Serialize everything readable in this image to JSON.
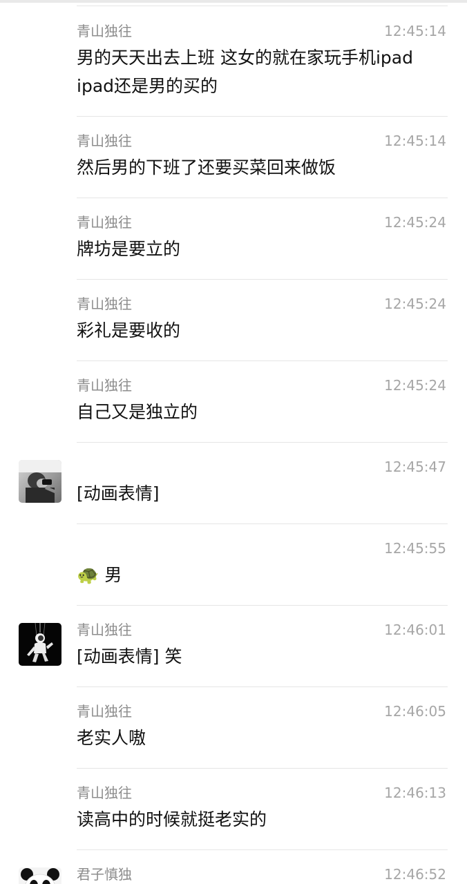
{
  "messages": [
    {
      "sender": "青山独往",
      "time": "12:45:14",
      "lines": [
        "男的天天出去上班 这女的就在家玩手机ipad",
        "ipad还是男的买的"
      ]
    },
    {
      "sender": "青山独往",
      "time": "12:45:14",
      "lines": [
        "然后男的下班了还要买菜回来做饭"
      ]
    },
    {
      "sender": "青山独往",
      "time": "12:45:24",
      "lines": [
        "牌坊是要立的"
      ]
    },
    {
      "sender": "青山独往",
      "time": "12:45:24",
      "lines": [
        "彩礼是要收的"
      ]
    },
    {
      "sender": "青山独往",
      "time": "12:45:24",
      "lines": [
        "自己又是独立的"
      ]
    },
    {
      "sender": "",
      "time": "12:45:47",
      "lines": [
        "[动画表情]"
      ]
    },
    {
      "sender": "",
      "time": "12:45:55",
      "lines": [
        "男"
      ],
      "emoji": "🐢"
    },
    {
      "sender": "青山独往",
      "time": "12:46:01",
      "lines": [
        "[动画表情] 笑"
      ]
    },
    {
      "sender": "青山独往",
      "time": "12:46:05",
      "lines": [
        "老实人嗷"
      ]
    },
    {
      "sender": "青山独往",
      "time": "12:46:13",
      "lines": [
        "读高中的时候就挺老实的"
      ]
    },
    {
      "sender": "君子慎独",
      "time": "12:46:52",
      "lines": []
    }
  ],
  "icons": {
    "avatar_1": "man-on-phone-photo",
    "avatar_2": "astronaut-on-black",
    "avatar_3": "panda-avatar"
  }
}
